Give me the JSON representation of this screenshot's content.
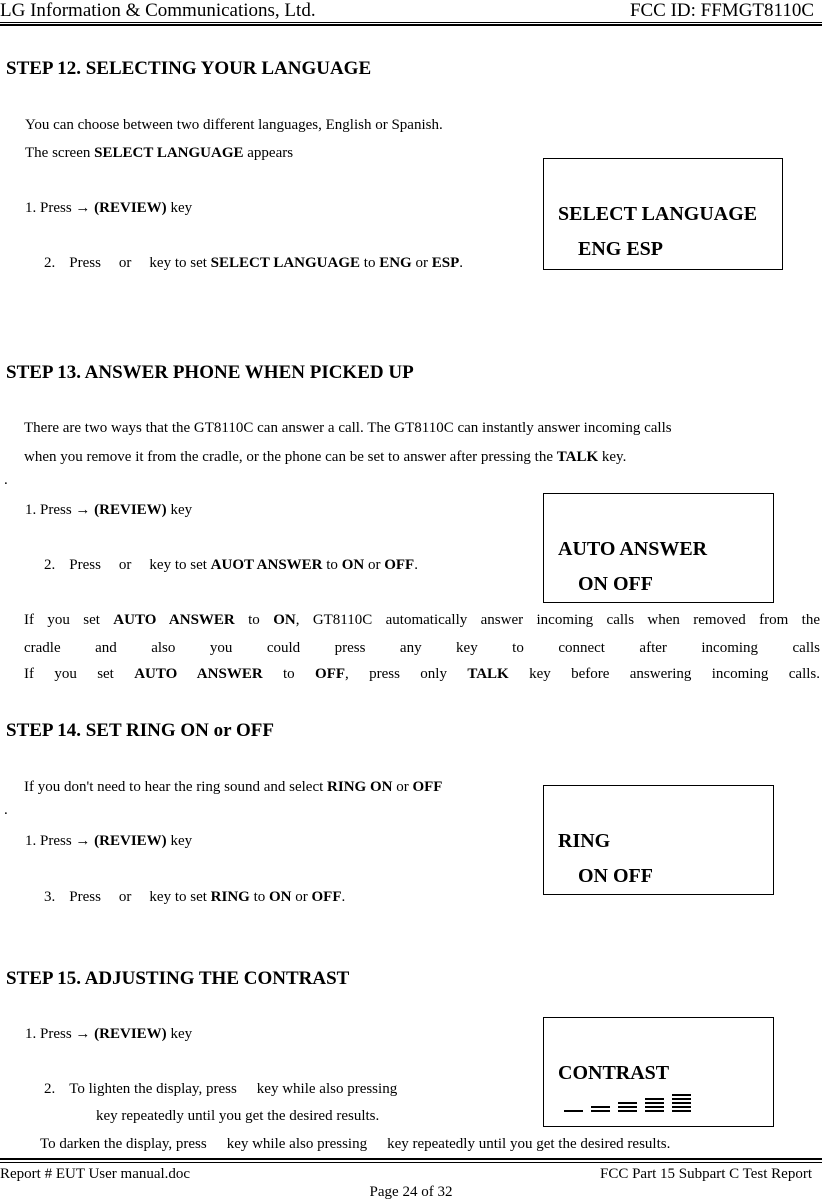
{
  "header": {
    "company": "LG Information & Communications, Ltd.",
    "fcc_id": "FCC ID: FFMGT8110C"
  },
  "steps": [
    {
      "title": "STEP  12.  SELECTING YOUR LANGUAGE",
      "intro_1": "You can choose between two different languages, English or Spanish.",
      "intro_2_pre": "The screen  ",
      "intro_2_bold": "SELECT LANGUAGE",
      "intro_2_post": "  appears",
      "item_1_pre": "1.  Press ",
      "item_1_arrow": "→",
      "item_1_bold": " (REVIEW)",
      "item_1_post": "  key",
      "item_2_num": "2.",
      "item_2_press": "Press",
      "item_2_or": "or",
      "item_2_text": "key to set ",
      "item_2_b1": "SELECT LANGUAGE",
      "item_2_to": " to ",
      "item_2_b2": "ENG",
      "item_2_or2": " or ",
      "item_2_b3": "ESP",
      "item_2_end": ".",
      "lcd_line1": "SELECT LANGUAGE",
      "lcd_line2": "ENG   ESP"
    },
    {
      "title": "STEP  13.  ANSWER PHONE WHEN PICKED UP",
      "intro_1": "There are two ways that the GT8110C can answer a call. The GT8110C can instantly answer incoming calls",
      "intro_2_pre": "when you remove it from the cradle, or the phone can be set to answer after pressing the ",
      "intro_2_bold": "TALK",
      "intro_2_post": " key.",
      "stray_dot": ".",
      "item_1_pre": "1.  Press ",
      "item_1_arrow": "→",
      "item_1_bold": " (REVIEW)",
      "item_1_post": "  key",
      "item_2_num": "2.",
      "item_2_press": "Press",
      "item_2_or": "or",
      "item_2_text": "key to set ",
      "item_2_b1": "AUOT ANSWER",
      "item_2_to": " to ",
      "item_2_b2": "ON",
      "item_2_or2": " or ",
      "item_2_b3": "OFF",
      "item_2_end": ".",
      "lcd_line1": "AUTO ANSWER",
      "lcd_line2": "ON   OFF",
      "para_1": {
        "t1": "If you set ",
        "b1": "AUTO ANSWER",
        "t2": " to ",
        "b2": "ON",
        "t3": ", GT8110C automatically answer incoming calls when removed from the"
      },
      "para_2": "cradle and also you could press any key to connect after incoming calls",
      "para_3": {
        "t1": "If you set ",
        "b1": "AUTO ANSWER",
        "t2": " to ",
        "b2": "OFF",
        "t3": ", press only ",
        "b3": "TALK",
        "t4": " key before answering incoming calls."
      }
    },
    {
      "title": "STEP  14. SET RING ON or OFF",
      "intro_1_pre": "If you don't need to hear the ring sound and select ",
      "intro_1_b1": "RING ON",
      "intro_1_or": " or ",
      "intro_1_b2": "OFF",
      "stray_dot": ".",
      "item_1_pre": "1.  Press ",
      "item_1_arrow": "→",
      "item_1_bold": " (REVIEW)",
      "item_1_post": "  key",
      "item_2_num": "3.",
      "item_2_press": "Press",
      "item_2_or": "or",
      "item_2_text": "key to set ",
      "item_2_b1": "RING",
      "item_2_to": " to ",
      "item_2_b2": "ON",
      "item_2_or2": " or ",
      "item_2_b3": "OFF",
      "item_2_end": ".",
      "lcd_line1": "RING",
      "lcd_line2": "ON   OFF"
    },
    {
      "title": "STEP  15. ADJUSTING THE CONTRAST",
      "item_1_pre": "1.  Press ",
      "item_1_arrow": "→",
      "item_1_bold": " (REVIEW)",
      "item_1_post": "  key",
      "item_2_num": "2.",
      "item_2_a": "To lighten the display, press",
      "item_2_b": "key while also pressing",
      "item_2_c": "key repeatedly until you get the desired results.",
      "darken_a": "To darken the display, press",
      "darken_b": "key while also pressing",
      "darken_c": "key repeatedly until you get the desired results.",
      "lcd_line1": "CONTRAST",
      "contrast_levels": [
        1,
        2,
        3,
        4,
        5
      ]
    }
  ],
  "footer": {
    "report": "Report # EUT User manual.doc",
    "title": "FCC Part 15 Subpart C Test Report",
    "page": "Page 24 of 32"
  }
}
